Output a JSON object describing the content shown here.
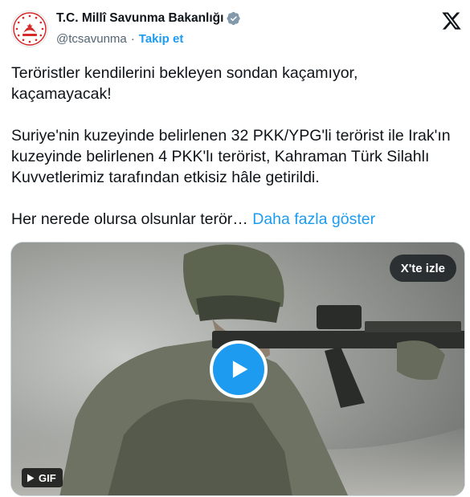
{
  "account": {
    "display_name": "T.C. Millî Savunma Bakanlığı",
    "handle": "@tcsavunma",
    "separator": "·",
    "follow_label": "Takip et",
    "verified": true
  },
  "tweet": {
    "line1": "Teröristler kendilerini bekleyen sondan kaçamıyor,",
    "line2": "kaçamayacak!",
    "paragraph2": "Suriye'nin kuzeyinde belirlenen 32 PKK/YPG'li terörist ile Irak'ın kuzeyinde belirlenen 4 PKK'lı terörist, Kahraman Türk Silahlı Kuvvetlerimiz tarafından etkisiz hâle getirildi.",
    "paragraph3": "Her nerede olursa olsunlar terör…",
    "show_more_label": "Daha fazla göster"
  },
  "media": {
    "watch_label": "X'te izle",
    "gif_label": "GIF",
    "play_icon": "play-icon",
    "gif_icon": "play-small-icon"
  },
  "icons": {
    "top_right": "x-logo-icon",
    "badge": "verified-badge-icon",
    "avatar": "ministry-emblem-icon"
  },
  "colors": {
    "accent": "#1d9bf0",
    "text": "#0f1419",
    "muted": "#536471",
    "emblem_red": "#d42a2a"
  }
}
